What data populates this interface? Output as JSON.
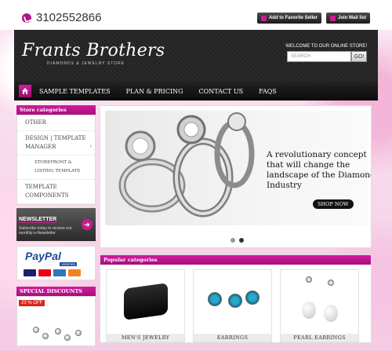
{
  "colors": {
    "accent": "#b2158a",
    "header_bg": "#262626"
  },
  "topbar": {
    "phone": "3102552866",
    "links": [
      "Add to Favorite Seller",
      "Join Mail list"
    ]
  },
  "header": {
    "logo": "Frants Brothers",
    "tagline": "DIAMONDS & JEWELRY STORE",
    "welcome": "WELCOME TO OUR ONLINE STORE!",
    "search_placeholder": "SEARCH",
    "search_button": "GO!"
  },
  "nav": {
    "items": [
      "SAMPLE TEMPLATES",
      "PLAN & PRICING",
      "CONTACT US",
      "FAQS"
    ]
  },
  "sidebar": {
    "categories_title": "Store categories",
    "categories": [
      {
        "label": "OTHER"
      },
      {
        "label": "DESIGN | TEMPLATE MANAGER"
      },
      {
        "label": "STOREFRONT & LISTING TEMPLATE"
      },
      {
        "label": "TEMPLATE COMPONENTS"
      }
    ],
    "newsletter": {
      "title": "NEWSLETTER",
      "text": "Subscribe today to receive our monthly e-Newsletter"
    },
    "paypal": {
      "logo": "PayPal",
      "verified": "VERIFIED"
    },
    "special": {
      "title": "SPECIAL DISCOUNTS",
      "badge": "23 % OFF"
    }
  },
  "slider": {
    "headline": "A revolutionary concept that will change the landscape of the Diamond Industry",
    "button": "SHOP NOW"
  },
  "popular": {
    "title": "Popular categories",
    "items": [
      {
        "label": "MEN'S JEWELRY"
      },
      {
        "label": "EARRINGS"
      },
      {
        "label": "PEARL EARRINGS"
      }
    ]
  }
}
